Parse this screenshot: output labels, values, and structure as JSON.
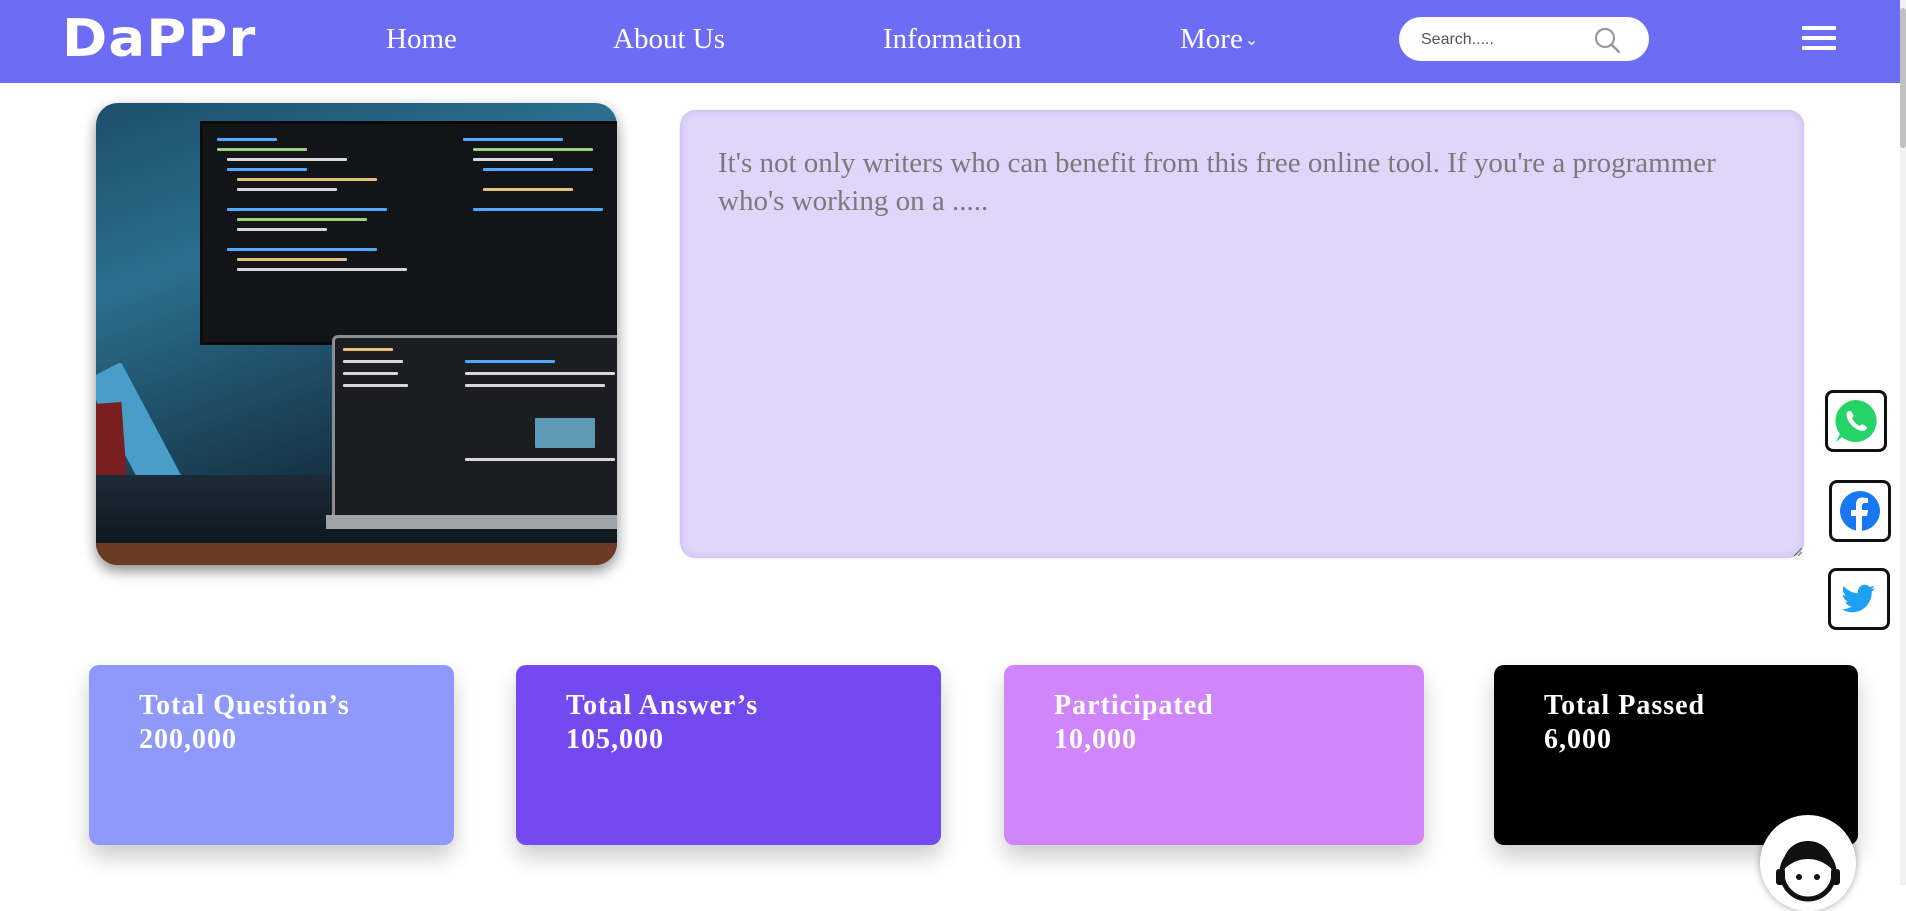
{
  "brand": {
    "logo_text": "DaPPr"
  },
  "nav": {
    "items": [
      {
        "label": "Home"
      },
      {
        "label": "About Us"
      },
      {
        "label": "Information"
      },
      {
        "label": "More"
      }
    ],
    "more_chevron": "⌄"
  },
  "search": {
    "placeholder": "Search.....",
    "icon": "search-icon"
  },
  "menu": {
    "icon": "hamburger-menu-icon"
  },
  "hero": {
    "image_alt": "Laptop and monitor showing code on a desk"
  },
  "textarea": {
    "placeholder": "It's not only writers who can benefit from this free online tool. If you're a programmer who's working on a ....."
  },
  "social": [
    {
      "name": "whatsapp",
      "icon": "whatsapp-icon",
      "color": "#25d366"
    },
    {
      "name": "facebook",
      "icon": "facebook-icon",
      "color": "#1877f2"
    },
    {
      "name": "twitter",
      "icon": "twitter-icon",
      "color": "#1da1f2"
    }
  ],
  "stats": [
    {
      "label": "Total Question’s",
      "value": "200,000",
      "color": "#8e99fb"
    },
    {
      "label": "Total Answer’s",
      "value": "105,000",
      "color": "#7549f0"
    },
    {
      "label": "Participated",
      "value": "10,000",
      "color": "#d185fb"
    },
    {
      "label": "Total Passed",
      "value": "6,000",
      "color": "#000000"
    }
  ],
  "colors": {
    "nav_bg": "#6c6cf5",
    "textarea_bg": "#e0d6fb"
  },
  "chat": {
    "icon": "support-agent-icon"
  }
}
